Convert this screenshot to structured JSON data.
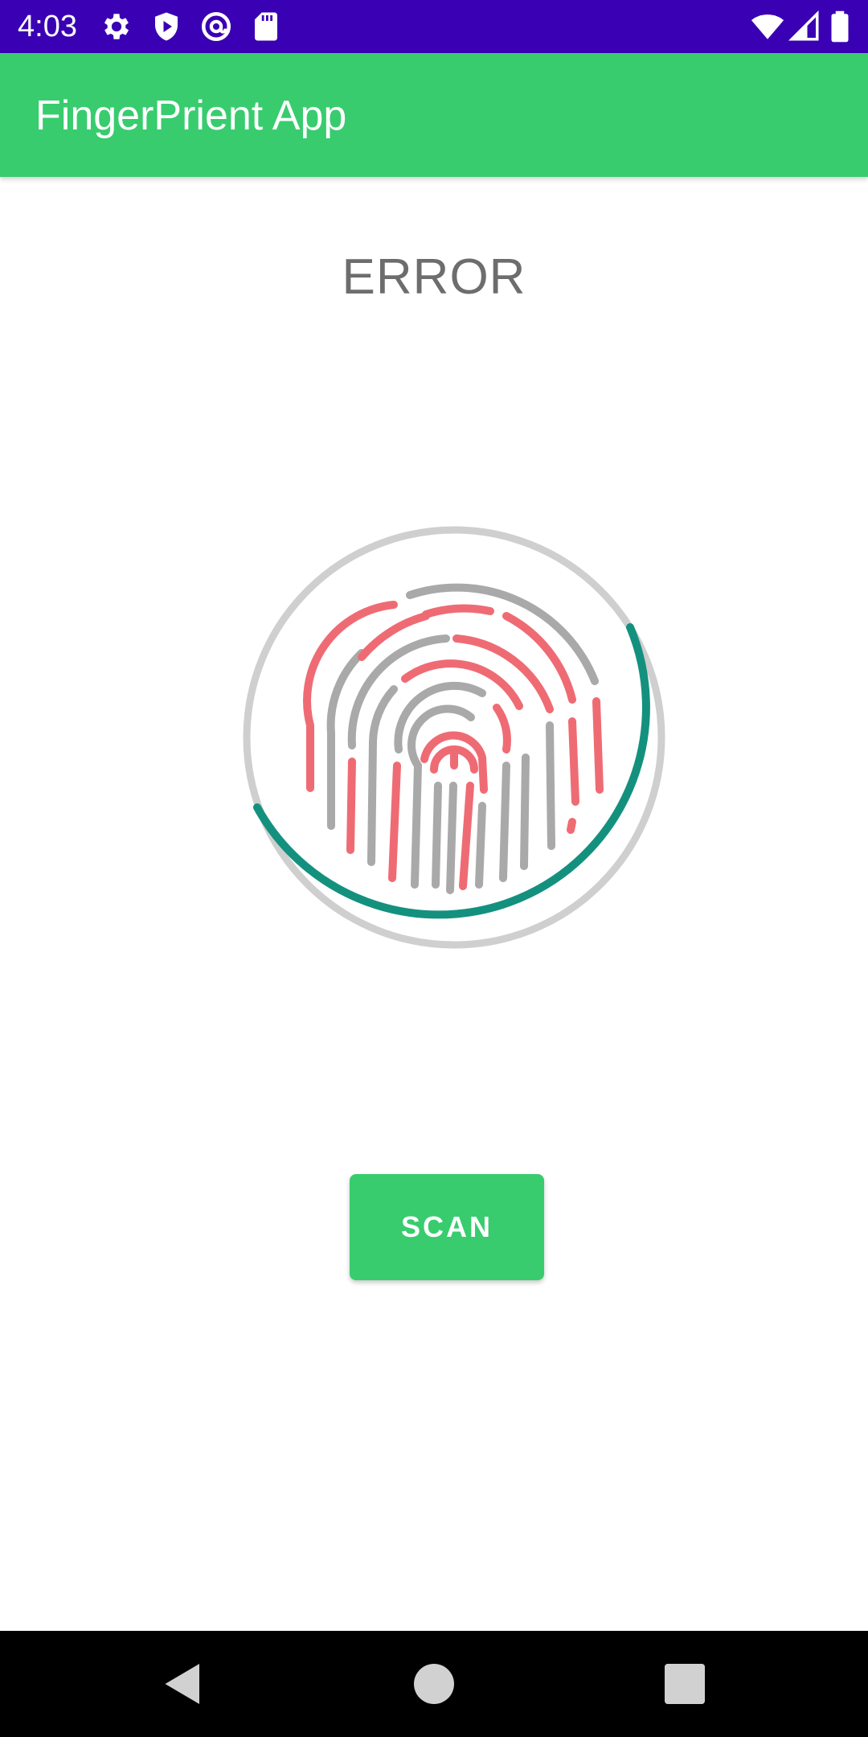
{
  "status_bar": {
    "time": "4:03",
    "left_icons": [
      "gear-icon",
      "shield-play-icon",
      "at-sign-icon",
      "sd-card-icon"
    ],
    "right_icons": [
      "wifi-icon",
      "signal-icon",
      "battery-icon"
    ],
    "background": "#3a00b4"
  },
  "app_bar": {
    "title": "FingerPrient App",
    "background": "#38cc6e"
  },
  "main": {
    "status_text": "ERROR",
    "fingerprint_icon": "fingerprint-icon",
    "colors": {
      "ring_gray": "#cfcfcf",
      "ring_progress": "#14917e",
      "ridge_red": "#ef6b74",
      "ridge_gray": "#a9a9a9"
    },
    "scan_button": {
      "label": "SCAN"
    }
  },
  "nav_bar": {
    "buttons": [
      "back-icon",
      "home-icon",
      "recents-icon"
    ]
  }
}
